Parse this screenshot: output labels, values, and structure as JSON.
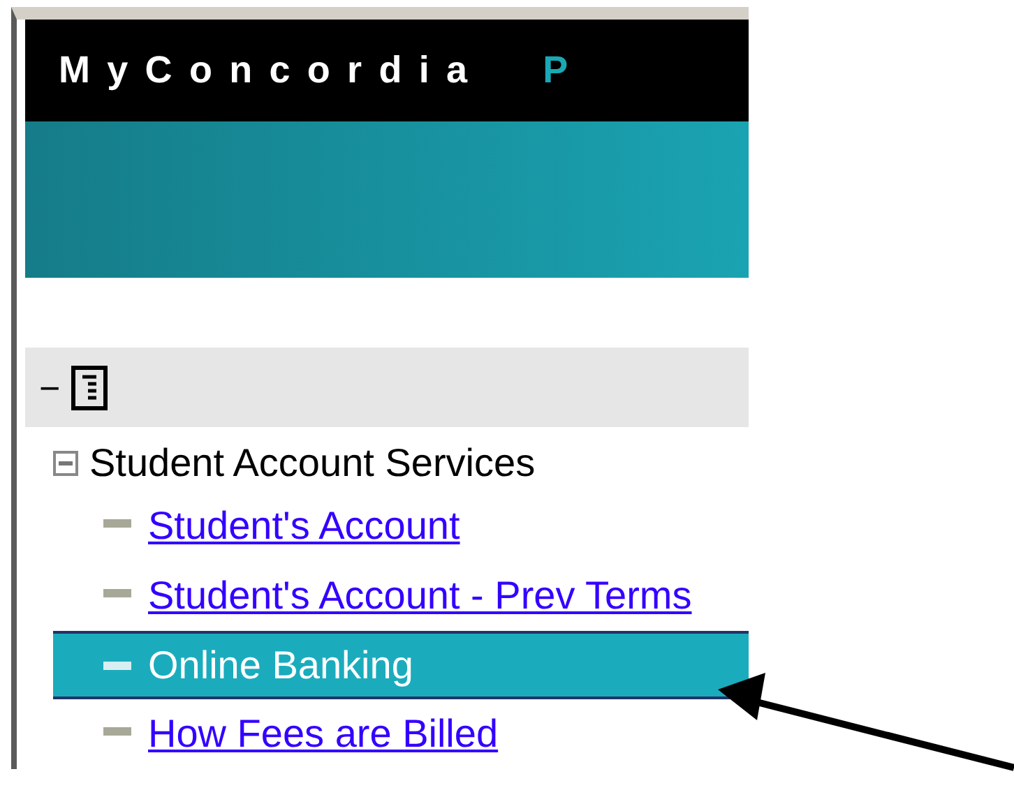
{
  "header": {
    "brand": "MyConcordia",
    "brand_cut": "P"
  },
  "section": {
    "collapse_glyph": "−"
  },
  "tree": {
    "label": "Student Account Services",
    "expanded": true,
    "children": [
      {
        "label": "Student's Account",
        "selected": false
      },
      {
        "label": "Student's Account - Prev Terms",
        "selected": false
      },
      {
        "label": "Online Banking",
        "selected": true
      },
      {
        "label": "How Fees are Billed",
        "selected": false
      }
    ]
  }
}
